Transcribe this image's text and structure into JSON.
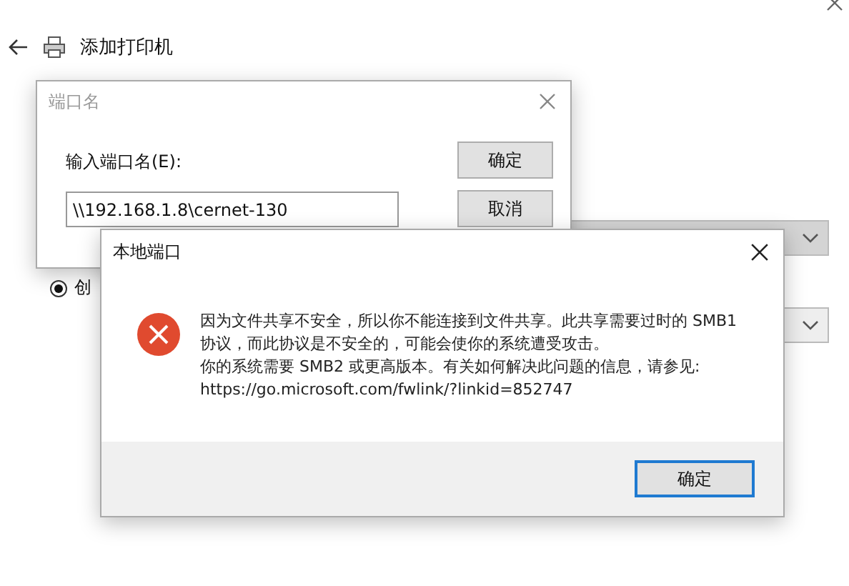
{
  "window": {
    "title": "添加打印机"
  },
  "background": {
    "radio": {
      "label": "创",
      "selected": true
    }
  },
  "port_dialog": {
    "title": "端口名",
    "field_label": "输入端口名(E):",
    "value": "\\\\192.168.1.8\\cernet-130",
    "buttons": [
      "确定",
      "取消"
    ]
  },
  "error_dialog": {
    "title": "本地端口",
    "message_lines": [
      "因为文件共享不安全，所以你不能连接到文件共享。此共享需要过时的 SMB1",
      "协议，而此协议是不安全的，可能会使你的系统遭受攻击。",
      "你的系统需要 SMB2 或更高版本。有关如何解决此问题的信息，请参见:",
      "https://go.microsoft.com/fwlink/?linkid=852747"
    ],
    "button": "确定"
  }
}
